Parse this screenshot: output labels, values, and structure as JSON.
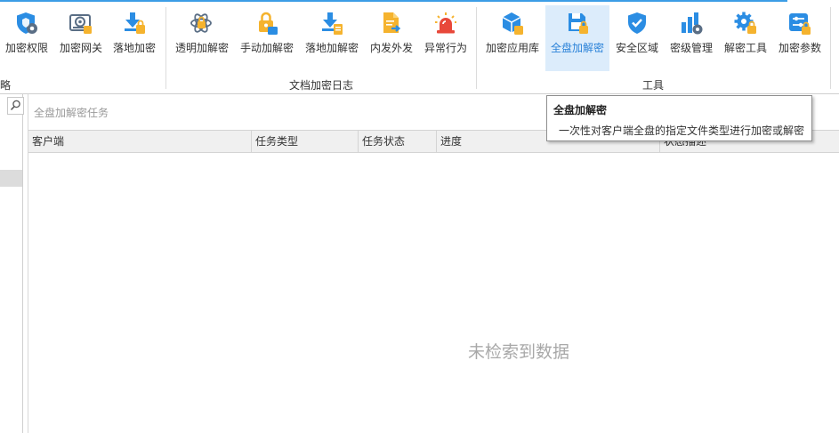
{
  "ribbon": {
    "buttons": [
      {
        "label": "加密权限",
        "icon": "shield-gear-icon"
      },
      {
        "label": "加密网关",
        "icon": "gateway-device-icon"
      },
      {
        "label": "落地加密",
        "icon": "download-lock-icon"
      },
      {
        "label": "透明加解密",
        "icon": "atom-lock-icon"
      },
      {
        "label": "手动加解密",
        "icon": "hand-lock-icon"
      },
      {
        "label": "落地加解密",
        "icon": "download-doc-icon"
      },
      {
        "label": "内发外发",
        "icon": "file-send-icon"
      },
      {
        "label": "异常行为",
        "icon": "alarm-siren-icon"
      },
      {
        "label": "加密应用库",
        "icon": "cube-gear-icon"
      },
      {
        "label": "全盘加解密",
        "icon": "disk-lock-icon"
      },
      {
        "label": "安全区域",
        "icon": "shield-check-icon"
      },
      {
        "label": "密级管理",
        "icon": "bar-chart-gear-icon"
      },
      {
        "label": "解密工具",
        "icon": "gear-lock-icon"
      },
      {
        "label": "加密参数",
        "icon": "sliders-lock-icon"
      }
    ],
    "groups": {
      "policy": "略",
      "log": "文档加密日志",
      "tools": "工具"
    },
    "active_index": 9
  },
  "colors": {
    "accent": "#2a82d8",
    "active_bg": "#dcecfb",
    "icon_blue": "#2b8de3",
    "icon_yellow": "#f5b32e",
    "icon_red": "#e8483a"
  },
  "search": {
    "placeholder": "全盘加解密任务"
  },
  "table": {
    "columns": [
      "客户端",
      "任务类型",
      "任务状态",
      "进度",
      "状态描述"
    ],
    "rows": [],
    "empty_text": "未检索到数据"
  },
  "tooltip": {
    "title": "全盘加解密",
    "description": "一次性对客户端全盘的指定文件类型进行加密或解密"
  }
}
